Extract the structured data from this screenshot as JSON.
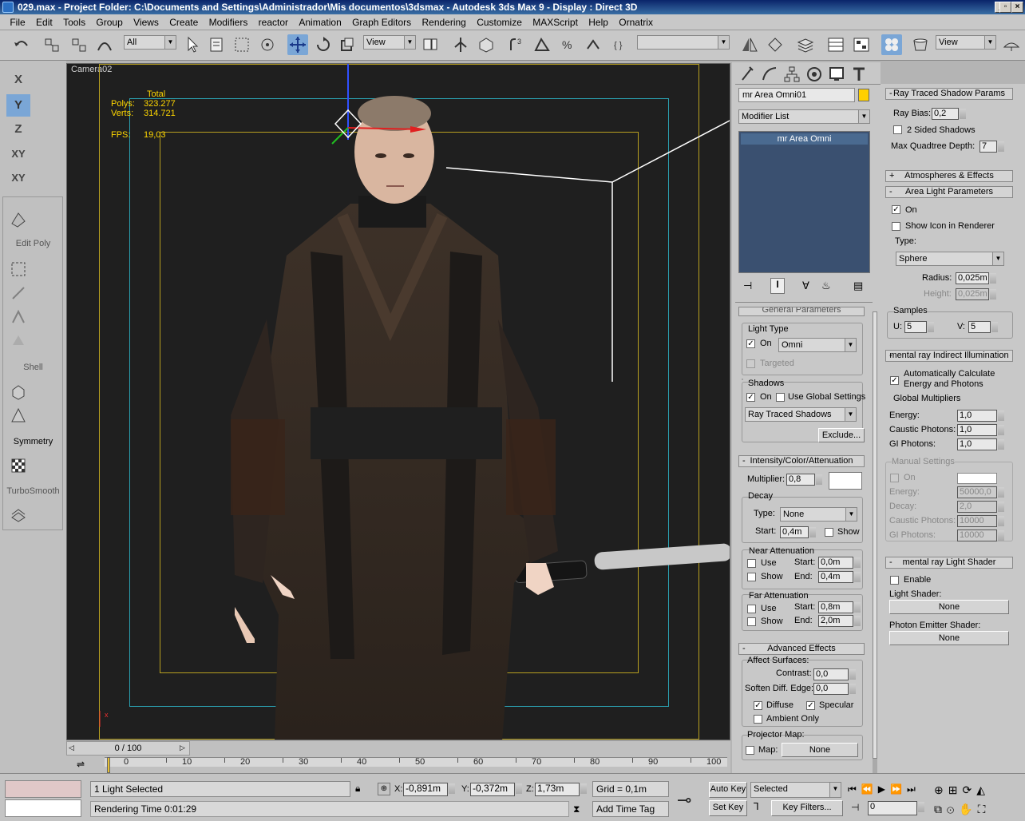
{
  "window": {
    "title": "029.max    - Project Folder: C:\\Documents and Settings\\Administrador\\Mis documentos\\3dsmax    - Autodesk 3ds Max 9    - Display : Direct 3D"
  },
  "menu": [
    "File",
    "Edit",
    "Tools",
    "Group",
    "Views",
    "Create",
    "Modifiers",
    "reactor",
    "Animation",
    "Graph Editors",
    "Rendering",
    "Customize",
    "MAXScript",
    "Help",
    "Ornatrix"
  ],
  "toolbar": {
    "selection_filter": "All",
    "ref_coord": "View",
    "named_sel": "",
    "view_dd": "View"
  },
  "viewport": {
    "label": "Camera02",
    "stats": {
      "total": "Total",
      "polys_label": "Polys:",
      "polys": "323.277",
      "verts_label": "Verts:",
      "verts": "314.721",
      "fps_label": "FPS:",
      "fps": "19,03"
    }
  },
  "left_toolbar": {
    "axes": [
      "X",
      "Y",
      "Z",
      "XY",
      "XY"
    ],
    "labels": {
      "edit_poly": "Edit Poly",
      "shell": "Shell",
      "symmetry": "Symmetry",
      "turbosmooth": "TurboSmooth"
    }
  },
  "command_panel": {
    "object_name": "mr Area Omni01",
    "object_color": "#ffd000",
    "modifier_list": "Modifier List",
    "stack": [
      "mr Area Omni"
    ],
    "general": {
      "header": "General Parameters",
      "light_type_group": "Light Type",
      "on": "On",
      "on_checked": true,
      "type": "Omni",
      "targeted": "Targeted",
      "shadows_group": "Shadows",
      "shadows_on": "On",
      "use_global": "Use Global Settings",
      "shadow_type": "Ray Traced Shadows",
      "exclude": "Exclude..."
    },
    "intensity": {
      "header": "Intensity/Color/Attenuation",
      "multiplier_label": "Multiplier:",
      "multiplier": "0,8",
      "decay_group": "Decay",
      "type_label": "Type:",
      "type": "None",
      "start_label": "Start:",
      "start": "0,4m",
      "show": "Show",
      "near": {
        "title": "Near Attenuation",
        "use": "Use",
        "show": "Show",
        "start_label": "Start:",
        "start": "0,0m",
        "end_label": "End:",
        "end": "0,4m"
      },
      "far": {
        "title": "Far Attenuation",
        "use": "Use",
        "show": "Show",
        "start_label": "Start:",
        "start": "0,8m",
        "end_label": "End:",
        "end": "2,0m"
      }
    },
    "advanced": {
      "header": "Advanced Effects",
      "affect_group": "Affect Surfaces:",
      "contrast_label": "Contrast:",
      "contrast": "0,0",
      "soften_label": "Soften Diff. Edge:",
      "soften": "0,0",
      "diffuse": "Diffuse",
      "specular": "Specular",
      "ambient": "Ambient Only",
      "projector_group": "Projector Map:",
      "map": "Map:",
      "map_value": "None"
    }
  },
  "right_panel": {
    "ray_traced": {
      "header": "Ray Traced Shadow Params",
      "ray_bias_label": "Ray Bias:",
      "ray_bias": "0,2",
      "two_sided": "2 Sided Shadows",
      "max_quad_label": "Max Quadtree Depth:",
      "max_quad": "7"
    },
    "atmos_header": "Atmospheres & Effects",
    "area": {
      "header": "Area Light Parameters",
      "on": "On",
      "show_icon": "Show Icon in Renderer",
      "type_label": "Type:",
      "type": "Sphere",
      "radius_label": "Radius:",
      "radius": "0,025m",
      "height_label": "Height:",
      "height": "0,025m",
      "samples_label": "Samples",
      "u_label": "U:",
      "u": "5",
      "v_label": "V:",
      "v": "5"
    },
    "indirect": {
      "header": "mental ray Indirect Illumination",
      "auto_calc": "Automatically Calculate Energy and Photons",
      "global_mult": "Global Multipliers",
      "energy_label": "Energy:",
      "energy": "1,0",
      "caustic_label": "Caustic Photons:",
      "caustic": "1,0",
      "gi_label": "GI Photons:",
      "gi": "1,0",
      "manual": "Manual Settings",
      "on": "On",
      "m_energy": "50000,0",
      "decay_label": "Decay:",
      "m_decay": "2,0",
      "m_caustic": "10000",
      "m_gi": "10000"
    },
    "shader": {
      "header": "mental ray Light Shader",
      "enable": "Enable",
      "light_shader_label": "Light Shader:",
      "light_shader": "None",
      "photon_label": "Photon Emitter Shader:",
      "photon": "None"
    }
  },
  "timeline": {
    "frame": "0 / 100",
    "ticks": [
      "0",
      "10",
      "20",
      "30",
      "40",
      "50",
      "60",
      "70",
      "80",
      "90",
      "100"
    ]
  },
  "status": {
    "selection": "1 Light Selected",
    "render_time": "Rendering Time  0:01:29",
    "x_label": "X:",
    "x": "-0,891m",
    "y_label": "Y:",
    "y": "-0,372m",
    "z_label": "Z:",
    "z": "1,73m",
    "grid": "Grid = 0,1m",
    "add_time_tag": "Add Time Tag",
    "auto_key": "Auto Key",
    "set_key": "Set Key",
    "key_mode": "Selected",
    "key_filters": "Key Filters...",
    "frame": "0"
  }
}
